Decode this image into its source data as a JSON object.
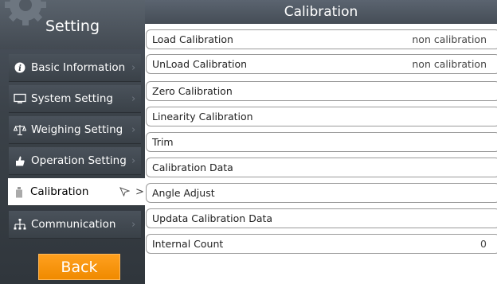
{
  "sidebar": {
    "title": "Setting",
    "items": [
      {
        "label": "Basic Information",
        "icon": "info-icon",
        "active": false
      },
      {
        "label": "System Setting",
        "icon": "monitor-icon",
        "active": false
      },
      {
        "label": "Weighing Setting",
        "icon": "scale-icon",
        "active": false
      },
      {
        "label": "Operation Setting",
        "icon": "thumb-icon",
        "active": false
      },
      {
        "label": "Calibration",
        "icon": "weight-icon",
        "active": true
      },
      {
        "label": "Communication",
        "icon": "network-icon",
        "active": false
      }
    ],
    "back_label": "Back"
  },
  "main": {
    "title": "Calibration",
    "rows": [
      {
        "label": "Load Calibration",
        "value": "non calibration"
      },
      {
        "label": "UnLoad Calibration",
        "value": "non calibration"
      },
      {
        "label": "Zero Calibration",
        "value": ""
      },
      {
        "label": "Linearity Calibration",
        "value": ""
      },
      {
        "label": "Trim",
        "value": ""
      },
      {
        "label": "Calibration Data",
        "value": ""
      },
      {
        "label": "Angle Adjust",
        "value": ""
      },
      {
        "label": "Updata Calibration Data",
        "value": ""
      },
      {
        "label": "Internal Count",
        "value": "0"
      }
    ]
  },
  "colors": {
    "accent": "#f39000",
    "sidebar": "#3b4249",
    "header": "#4f5862"
  }
}
